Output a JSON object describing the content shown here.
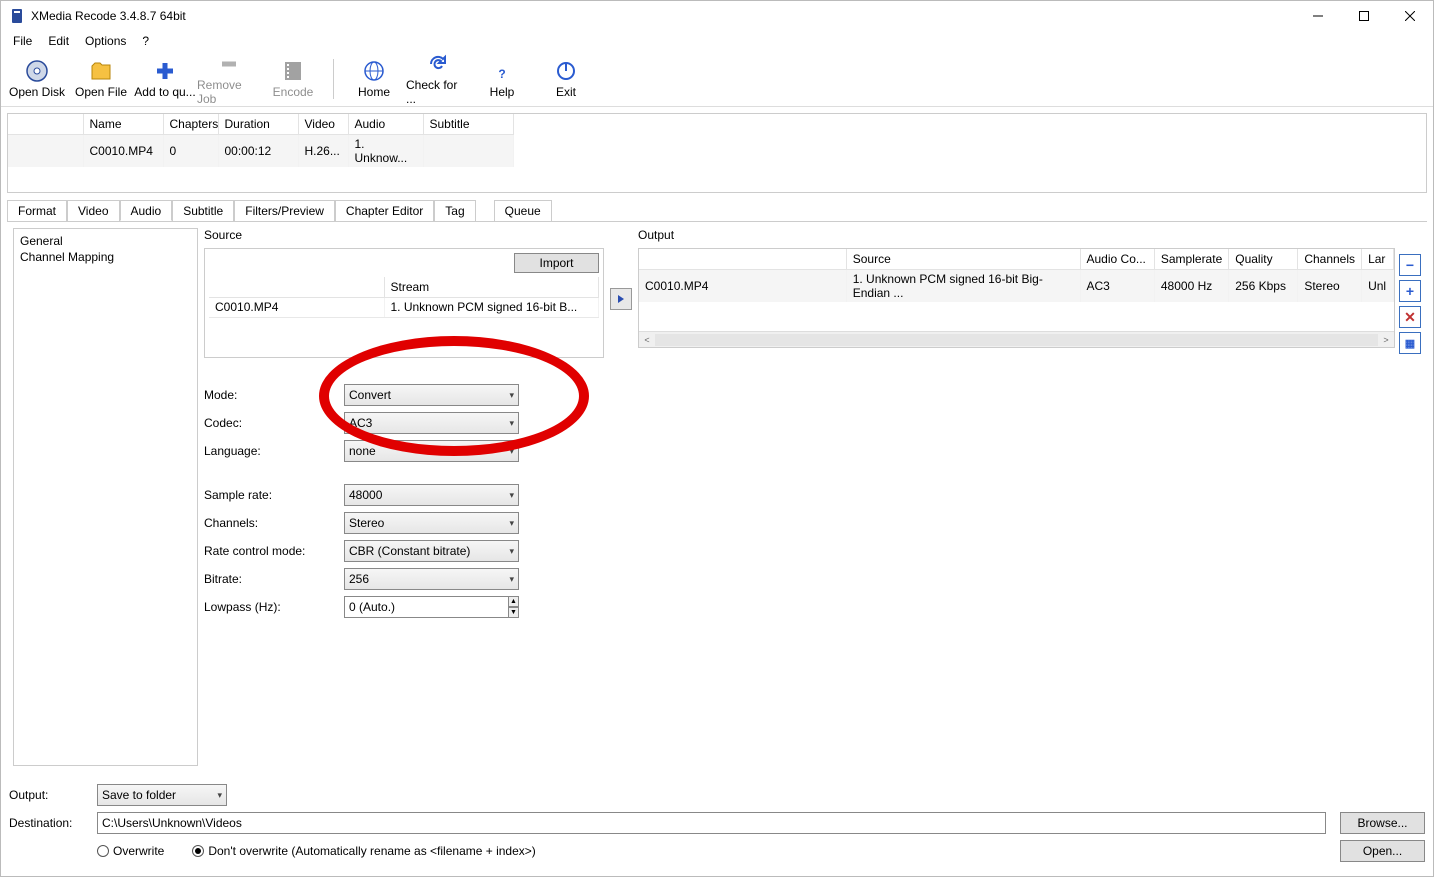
{
  "title": "XMedia Recode 3.4.8.7 64bit",
  "menus": [
    "File",
    "Edit",
    "Options",
    "?"
  ],
  "toolbar": [
    {
      "label": "Open Disk",
      "icon": "disc"
    },
    {
      "label": "Open File",
      "icon": "folder"
    },
    {
      "label": "Add to qu...",
      "icon": "plus"
    },
    {
      "label": "Remove Job",
      "icon": "minus",
      "disabled": true
    },
    {
      "label": "Encode",
      "icon": "film",
      "disabled": true
    },
    {
      "sep": true
    },
    {
      "label": "Home",
      "icon": "globe"
    },
    {
      "label": "Check for ...",
      "icon": "refresh"
    },
    {
      "label": "Help",
      "icon": "question"
    },
    {
      "label": "Exit",
      "icon": "power"
    }
  ],
  "file_table": {
    "cols": [
      "",
      "Name",
      "Chapters",
      "Duration",
      "Video",
      "Audio",
      "Subtitle"
    ],
    "row": [
      "",
      "C0010.MP4",
      "0",
      "00:00:12",
      "H.26...",
      "1. Unknow...",
      ""
    ]
  },
  "tabs": [
    "Format",
    "Video",
    "Audio",
    "Subtitle",
    "Filters/Preview",
    "Chapter Editor",
    "Tag",
    "Queue"
  ],
  "active_tab": 2,
  "left_items": [
    "General",
    "Channel Mapping"
  ],
  "source": {
    "title": "Source",
    "import": "Import",
    "col_stream": "Stream",
    "name": "C0010.MP4",
    "stream": "1. Unknown PCM signed 16-bit B..."
  },
  "form": {
    "mode": {
      "label": "Mode:",
      "value": "Convert"
    },
    "codec": {
      "label": "Codec:",
      "value": "AC3"
    },
    "language": {
      "label": "Language:",
      "value": "none"
    },
    "sample": {
      "label": "Sample rate:",
      "value": "48000"
    },
    "channels": {
      "label": "Channels:",
      "value": "Stereo"
    },
    "rate": {
      "label": "Rate control mode:",
      "value": "CBR (Constant bitrate)"
    },
    "bitrate": {
      "label": "Bitrate:",
      "value": "256"
    },
    "lowpass": {
      "label": "Lowpass (Hz):",
      "value": "0 (Auto.)"
    }
  },
  "output": {
    "title": "Output",
    "cols": [
      "",
      "Source",
      "Audio Co...",
      "Samplerate",
      "Quality",
      "Channels",
      "Lar"
    ],
    "row": [
      "C0010.MP4",
      "1. Unknown PCM signed 16-bit Big-Endian ...",
      "AC3",
      "48000 Hz",
      "256 Kbps",
      "Stereo",
      "Unl"
    ]
  },
  "bottom": {
    "output_label": "Output:",
    "output_mode": "Save to folder",
    "dest_label": "Destination:",
    "dest_path": "C:\\Users\\Unknown\\Videos",
    "browse": "Browse...",
    "open": "Open...",
    "overwrite": "Overwrite",
    "dont_overwrite": "Don't overwrite (Automatically rename as <filename + index>)"
  }
}
